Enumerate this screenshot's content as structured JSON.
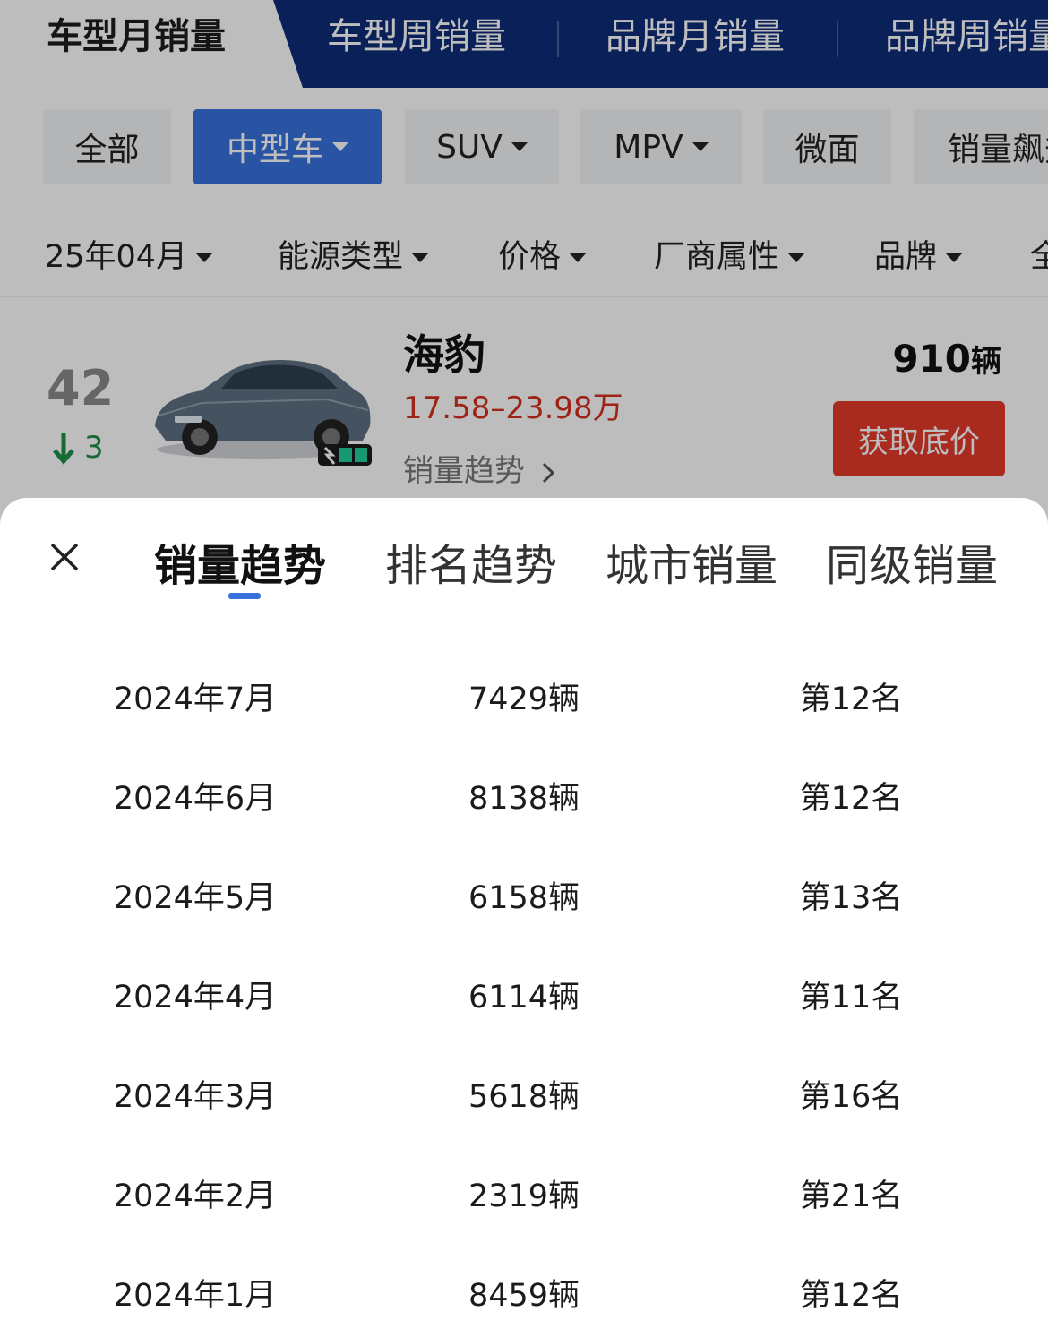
{
  "top_tabs": [
    {
      "label": "车型月销量"
    },
    {
      "label": "车型周销量"
    },
    {
      "label": "品牌月销量"
    },
    {
      "label": "品牌周销量"
    }
  ],
  "chips": [
    {
      "label": "全部"
    },
    {
      "label": "中型车"
    },
    {
      "label": "SUV"
    },
    {
      "label": "MPV"
    },
    {
      "label": "微面"
    },
    {
      "label": "销量飙升"
    }
  ],
  "filters": [
    {
      "label": "25年04月"
    },
    {
      "label": "能源类型"
    },
    {
      "label": "价格"
    },
    {
      "label": "厂商属性"
    },
    {
      "label": "品牌"
    },
    {
      "label": "全"
    }
  ],
  "car": {
    "rank": "42",
    "rank_change": "3",
    "name": "海豹",
    "price": "17.58–23.98万",
    "trend_link": "销量趋势",
    "sales_value": "910",
    "sales_unit": "辆",
    "quote_button": "获取底价"
  },
  "sheet": {
    "tabs": [
      {
        "label": "销量趋势"
      },
      {
        "label": "排名趋势"
      },
      {
        "label": "城市销量"
      },
      {
        "label": "同级销量"
      }
    ],
    "rows": [
      {
        "month": "2024年7月",
        "sales": "7429辆",
        "rank": "第12名"
      },
      {
        "month": "2024年6月",
        "sales": "8138辆",
        "rank": "第12名"
      },
      {
        "month": "2024年5月",
        "sales": "6158辆",
        "rank": "第13名"
      },
      {
        "month": "2024年4月",
        "sales": "6114辆",
        "rank": "第11名"
      },
      {
        "month": "2024年3月",
        "sales": "5618辆",
        "rank": "第16名"
      },
      {
        "month": "2024年2月",
        "sales": "2319辆",
        "rank": "第21名"
      },
      {
        "month": "2024年1月",
        "sales": "8459辆",
        "rank": "第12名"
      }
    ]
  },
  "colors": {
    "nav_bg": "#0e2c77",
    "accent_blue": "#3772dc",
    "price_red": "#d5301f",
    "button_red": "#e53a2c",
    "rank_down_green": "#1f8e4a"
  }
}
